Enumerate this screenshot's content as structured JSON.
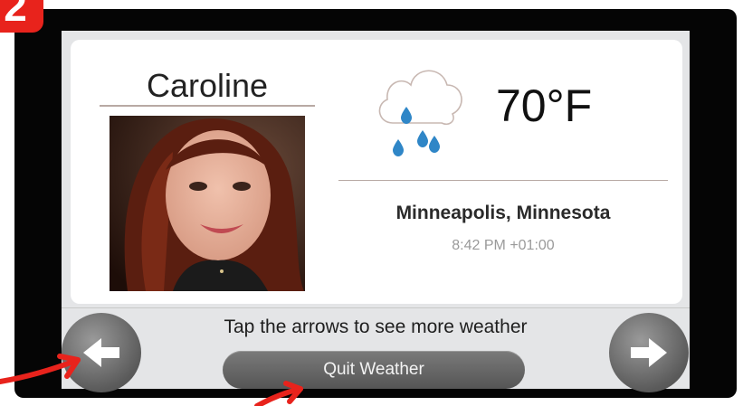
{
  "step_badge": "2",
  "profile": {
    "name": "Caroline"
  },
  "weather": {
    "temperature": "70°F",
    "condition_icon": "rain-cloud-icon",
    "location": "Minneapolis, Minnesota",
    "local_time": "8:42 PM +01:00"
  },
  "footer": {
    "hint": "Tap the arrows to see more weather",
    "quit_label": "Quit Weather"
  },
  "icons": {
    "prev": "arrow-left-icon",
    "next": "arrow-right-icon"
  },
  "colors": {
    "annotation_red": "#e8231c",
    "screen_bg": "#e4e5e7",
    "button_gray": "#666666",
    "raindrop_blue": "#2f86c7"
  }
}
